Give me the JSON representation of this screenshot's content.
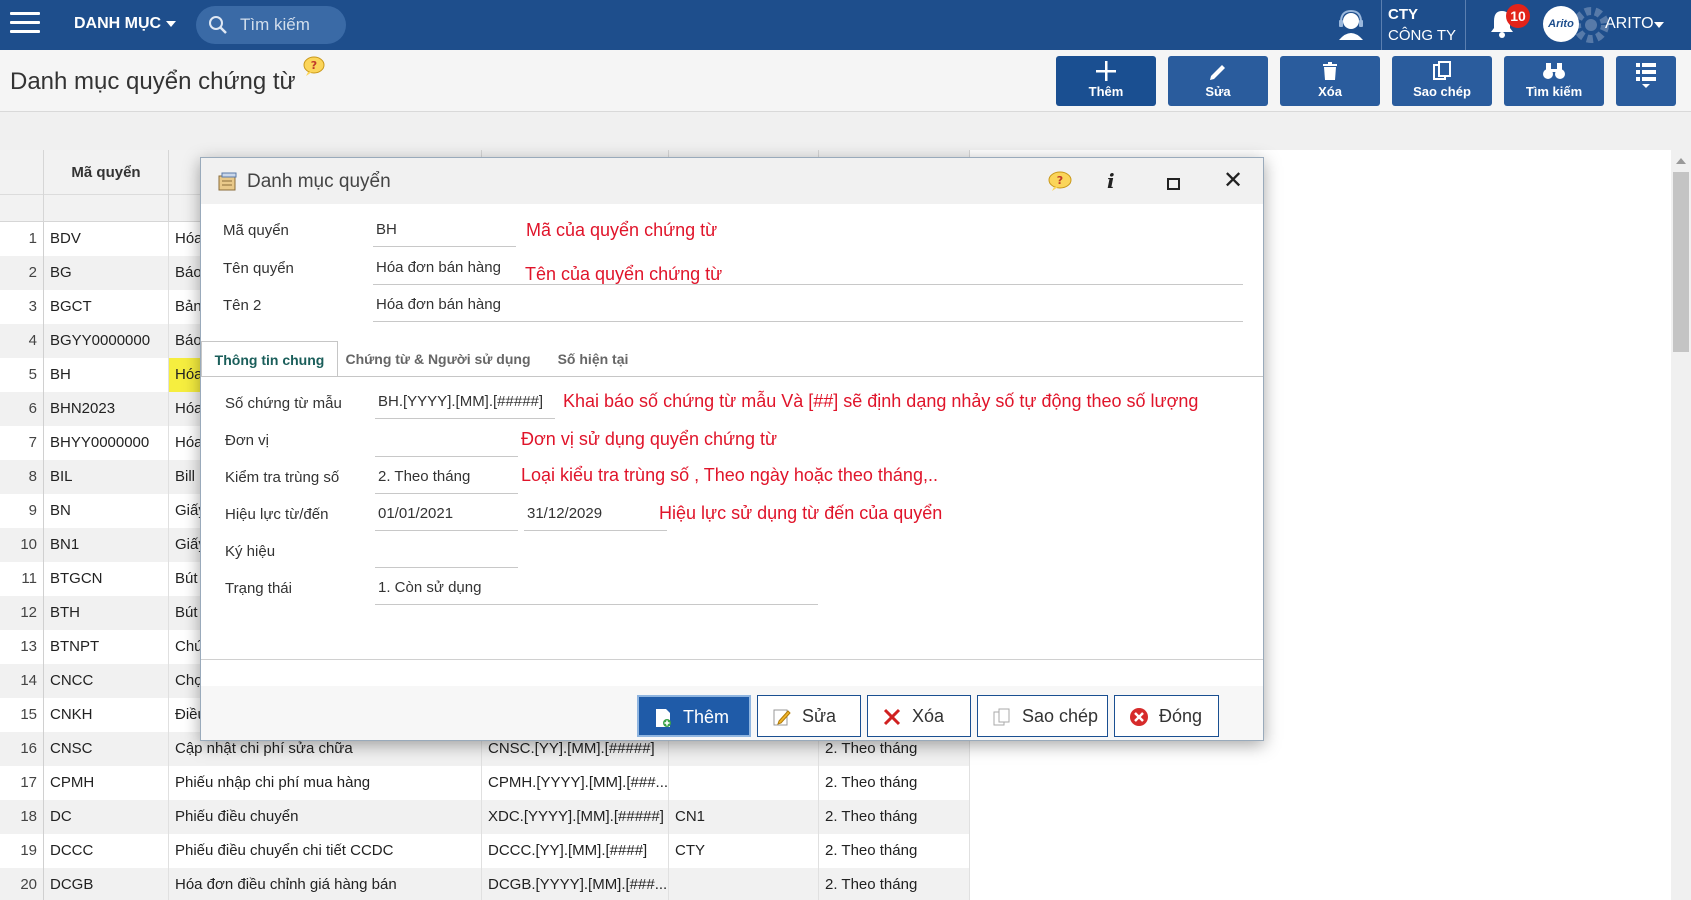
{
  "topbar": {
    "menu_title": "DANH MỤC",
    "search_placeholder": "Tìm kiếm",
    "company_code": "CTY",
    "company_name": "CÔNG TY",
    "notification_count": "10",
    "avatar_text": "Arito",
    "user_name": "ARITO"
  },
  "page": {
    "title": "Danh mục quyển chứng từ"
  },
  "toolbar": {
    "add": "Thêm",
    "edit": "Sửa",
    "delete": "Xóa",
    "copy": "Sao chép",
    "search": "Tìm kiếm"
  },
  "grid": {
    "header_code": "Mã quyển",
    "rows": [
      {
        "n": "1",
        "code": "BDV",
        "name": "Hóa",
        "fmt": "",
        "unit": "",
        "check": ""
      },
      {
        "n": "2",
        "code": "BG",
        "name": "Báo",
        "fmt": "",
        "unit": "",
        "check": ""
      },
      {
        "n": "3",
        "code": "BGCT",
        "name": "Bản",
        "fmt": "",
        "unit": "",
        "check": ""
      },
      {
        "n": "4",
        "code": "BGYY0000000",
        "name": "Báo",
        "fmt": "",
        "unit": "",
        "check": ""
      },
      {
        "n": "5",
        "code": "BH",
        "name": "Hóa",
        "fmt": "",
        "unit": "",
        "check": ""
      },
      {
        "n": "6",
        "code": "BHN2023",
        "name": "Hóa",
        "fmt": "",
        "unit": "",
        "check": ""
      },
      {
        "n": "7",
        "code": "BHYY0000000",
        "name": "Hóa",
        "fmt": "",
        "unit": "",
        "check": ""
      },
      {
        "n": "8",
        "code": "BIL",
        "name": "Bill I",
        "fmt": "",
        "unit": "",
        "check": ""
      },
      {
        "n": "9",
        "code": "BN",
        "name": "Giấy",
        "fmt": "",
        "unit": "",
        "check": ""
      },
      {
        "n": "10",
        "code": "BN1",
        "name": "Giấy",
        "fmt": "",
        "unit": "",
        "check": ""
      },
      {
        "n": "11",
        "code": "BTGCN",
        "name": "Bút",
        "fmt": "",
        "unit": "",
        "check": ""
      },
      {
        "n": "12",
        "code": "BTH",
        "name": "Bút",
        "fmt": "",
        "unit": "",
        "check": ""
      },
      {
        "n": "13",
        "code": "BTNPT",
        "name": "Chứ",
        "fmt": "",
        "unit": "",
        "check": ""
      },
      {
        "n": "14",
        "code": "CNCC",
        "name": "Chọ",
        "fmt": "",
        "unit": "",
        "check": ""
      },
      {
        "n": "15",
        "code": "CNKH",
        "name": "Điều",
        "fmt": "",
        "unit": "",
        "check": ""
      },
      {
        "n": "16",
        "code": "CNSC",
        "name": "Cập nhật chi phí sửa chữa",
        "fmt": "CNSC.[YY].[MM].[#####]",
        "unit": "",
        "check": "2. Theo tháng"
      },
      {
        "n": "17",
        "code": "CPMH",
        "name": "Phiếu nhập chi phí mua hàng",
        "fmt": "CPMH.[YYYY].[MM].[###...",
        "unit": "",
        "check": "2. Theo tháng"
      },
      {
        "n": "18",
        "code": "DC",
        "name": "Phiếu điều chuyển",
        "fmt": "XDC.[YYYY].[MM].[#####]",
        "unit": "CN1",
        "check": "2. Theo tháng"
      },
      {
        "n": "19",
        "code": "DCCC",
        "name": "Phiếu điều chuyển chi tiết CCDC",
        "fmt": "DCCC.[YY].[MM].[####]",
        "unit": "CTY",
        "check": "2. Theo tháng"
      },
      {
        "n": "20",
        "code": "DCGB",
        "name": "Hóa đơn điều chỉnh giá hàng bán",
        "fmt": "DCGB.[YYYY].[MM].[###...",
        "unit": "",
        "check": "2. Theo tháng"
      }
    ]
  },
  "dialog": {
    "title": "Danh mục quyển",
    "ma_quyen_label": "Mã quyển",
    "ma_quyen_value": "BH",
    "ten_quyen_label": "Tên quyển",
    "ten_quyen_value": "Hóa đơn bán hàng",
    "ten2_label": "Tên 2",
    "ten2_value": "Hóa đơn bán hàng",
    "tabs": [
      "Thông tin chung",
      "Chứng từ & Người sử dụng",
      "Số hiện tại"
    ],
    "so_ct_mau_label": "Số chứng từ mẫu",
    "so_ct_mau_value": "BH.[YYYY].[MM].[#####]",
    "don_vi_label": "Đơn vị",
    "don_vi_value": "",
    "kiem_tra_label": "Kiểm tra trùng số",
    "kiem_tra_value": "2. Theo tháng",
    "hieu_luc_label": "Hiệu lực từ/đến",
    "hieu_luc_from": "01/01/2021",
    "hieu_luc_to": "31/12/2029",
    "ky_hieu_label": "Ký hiệu",
    "ky_hieu_value": "",
    "trang_thai_label": "Trạng thái",
    "trang_thai_value": "1. Còn sử dụng",
    "buttons": {
      "add": "Thêm",
      "edit": "Sửa",
      "delete": "Xóa",
      "copy": "Sao chép",
      "close": "Đóng"
    }
  },
  "annotations": {
    "ma_quyen": "Mã của quyển chứng từ",
    "ten_quyen": "Tên của quyển chứng từ",
    "so_ct_mau": "Khai báo số chứng từ mẫu Và [##] sẽ định dạng nhảy số tự động theo số lượng",
    "don_vi": "Đơn vị sử dụng quyển chứng từ",
    "kiem_tra": "Loại kiểu tra trùng số , Theo ngày hoặc theo tháng,..",
    "hieu_luc": "Hiệu lực sử dụng từ đến của quyển"
  },
  "colors": {
    "topbar": "#1e4e8c",
    "toolbar_button": "#2a5c9d",
    "annotation_text": "#e0142a",
    "row_highlight": "#f6ee3f"
  }
}
